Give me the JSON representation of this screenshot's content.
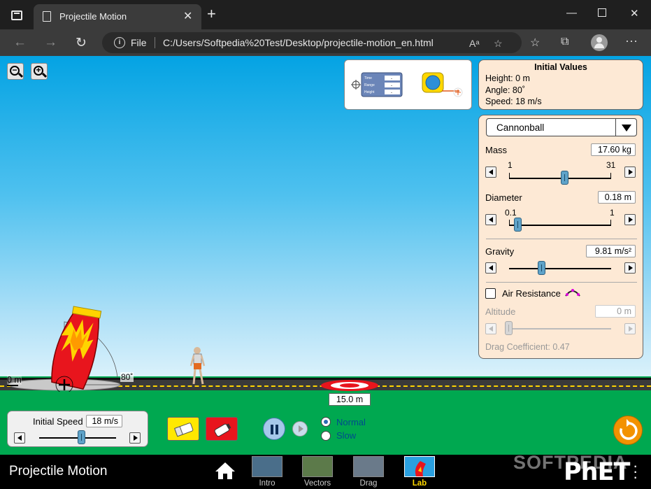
{
  "browser": {
    "tab_title": "Projectile Motion",
    "address_label": "File",
    "url": "C:/Users/Softpedia%20Test/Desktop/projectile-motion_en.html"
  },
  "initial_values": {
    "title": "Initial Values",
    "height": "Height: 0 m",
    "angle": "Angle: 80˚",
    "speed": "Speed: 18 m/s"
  },
  "toolbox": {
    "labels": [
      "Time",
      "Range",
      "Height"
    ],
    "values": [
      "-",
      "-",
      "-"
    ]
  },
  "projectile": {
    "selected": "Cannonball",
    "mass": {
      "label": "Mass",
      "value": "17.60 kg",
      "min": "1",
      "max": "31",
      "fraction": 0.55
    },
    "diameter": {
      "label": "Diameter",
      "value": "0.18 m",
      "min": "0.1",
      "max": "1",
      "fraction": 0.09
    },
    "gravity": {
      "label": "Gravity",
      "value": "9.81 m/s²",
      "fraction": 0.32
    },
    "air_resistance": {
      "label": "Air Resistance",
      "checked": false
    },
    "altitude": {
      "label": "Altitude",
      "value": "0 m",
      "fraction": 0.0
    },
    "drag": "Drag Coefficient: 0.47"
  },
  "scene": {
    "height_label": "0 m",
    "angle_label": "80˚",
    "target_distance": "15.0 m"
  },
  "initial_speed": {
    "label": "Initial Speed",
    "value": "18 m/s",
    "fraction": 0.55
  },
  "playback": {
    "normal": "Normal",
    "slow": "Slow",
    "selected": "Normal"
  },
  "navbar": {
    "title": "Projectile Motion",
    "screens": [
      "Intro",
      "Vectors",
      "Drag",
      "Lab"
    ],
    "active": "Lab",
    "logo": "PhET"
  },
  "watermark": "SOFTPEDIA",
  "colors": {
    "sky": "#04a3e3",
    "grass": "#00a850",
    "panel": "#fde9d5",
    "cannon": "#e8151d",
    "flame": "#ffd400",
    "target": "#e8151d",
    "reset": "#f39200"
  }
}
